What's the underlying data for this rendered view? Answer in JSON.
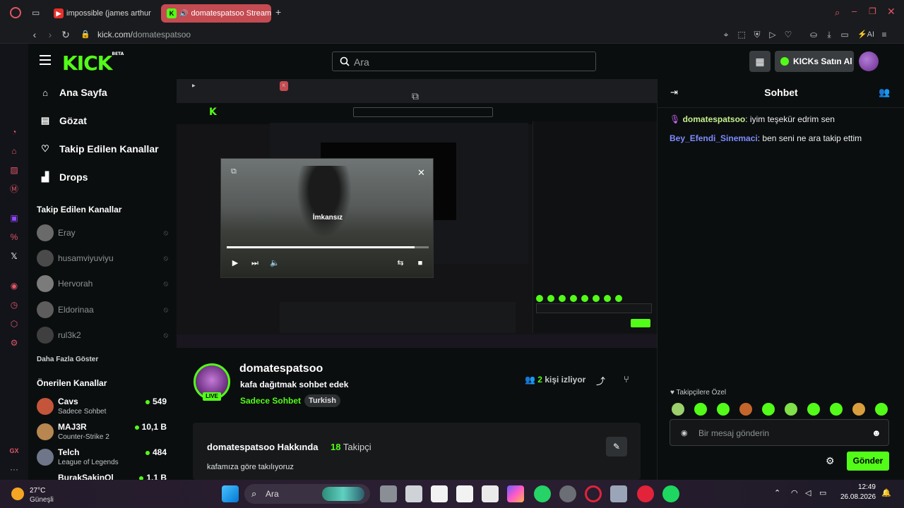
{
  "browser": {
    "tabs": [
      {
        "label": "impossible (james arthur",
        "icon": "youtube-icon"
      },
      {
        "label": "domatespatsoo Stream",
        "icon": "kick-icon"
      }
    ],
    "url_host": "kick.com/",
    "url_path": "domatespatsoo"
  },
  "header": {
    "logo": "KICK",
    "logo_badge": "BETA",
    "search_placeholder": "Ara",
    "buy_label": "KICKs Satın Al"
  },
  "nav": {
    "items": [
      {
        "label": "Ana Sayfa"
      },
      {
        "label": "Gözat"
      },
      {
        "label": "Takip Edilen Kanallar"
      },
      {
        "label": "Drops"
      }
    ],
    "followed_title": "Takip Edilen Kanallar",
    "followed": [
      {
        "name": "Eray"
      },
      {
        "name": "husamviyuviyu"
      },
      {
        "name": "Hervorah"
      },
      {
        "name": "Eldorinaa"
      },
      {
        "name": "rul3k2"
      }
    ],
    "show_more": "Daha Fazla Göster",
    "recommended_title": "Önerilen Kanallar",
    "recommended": [
      {
        "name": "Cavs",
        "category": "Sadece Sohbet",
        "viewers": "549"
      },
      {
        "name": "MAJ3R",
        "category": "Counter-Strike 2",
        "viewers": "10,1 B"
      },
      {
        "name": "Telch",
        "category": "League of Legends",
        "viewers": "484"
      },
      {
        "name": "BurakSakinOl",
        "category": "",
        "viewers": "1,1 B"
      }
    ]
  },
  "player": {
    "caption": "İmkansız",
    "progress": 0.93
  },
  "channel": {
    "name": "domatespatsoo",
    "title": "kafa dağıtmak sohbet edek",
    "category": "Sadece Sohbet",
    "tag": "Turkish",
    "live": "LIVE",
    "viewer_count": "2",
    "viewer_label": "kişi izliyor",
    "about_title": "domatespatsoo Hakkında",
    "followers_count": "18",
    "followers_label": "Takipçi",
    "description": "kafamıza göre takılıyoruz"
  },
  "chat": {
    "title": "Sohbet",
    "messages": [
      {
        "user": "domatespatsoo",
        "text": ": iyim teşekür edrim sen",
        "color": "#c5f08e"
      },
      {
        "user": "Bey_Efendi_Sinemaci",
        "text": ": ben seni ne ara takip ettim",
        "color": "#7c8cff"
      }
    ],
    "followers_only_label": "Takipçilere Özel",
    "input_placeholder": "Bir mesaj gönderin",
    "send_label": "Gönder"
  },
  "taskbar": {
    "weather_temp": "27°C",
    "weather_desc": "Güneşli",
    "search_placeholder": "Ara",
    "time": "12:49",
    "date": "26.08.2026"
  },
  "colors": {
    "accent": "#53fc18",
    "active_tab": "#c54b52"
  }
}
